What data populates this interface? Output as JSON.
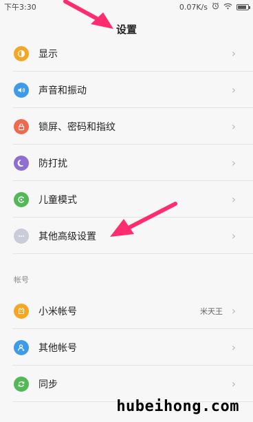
{
  "status": {
    "time": "下午3:30",
    "speed": "0.07K/s",
    "battery_level_percent": 85
  },
  "title": "设置",
  "group1": [
    {
      "label": "显示",
      "icon": "display-icon",
      "color": "#f5a623"
    },
    {
      "label": "声音和振动",
      "icon": "sound-icon",
      "color": "#3d9be9"
    },
    {
      "label": "锁屏、密码和指纹",
      "icon": "lock-icon",
      "color": "#f0684d"
    },
    {
      "label": "防打扰",
      "icon": "moon-icon",
      "color": "#8e6fd1"
    },
    {
      "label": "儿童模式",
      "icon": "kids-icon",
      "color": "#55b858"
    },
    {
      "label": "其他高级设置",
      "icon": "more-icon",
      "color": "#c8cdd8"
    }
  ],
  "section_account": "帐号",
  "group2": [
    {
      "label": "小米帐号",
      "value": "米天王",
      "icon": "mi-account-icon",
      "color": "#f5a623"
    },
    {
      "label": "其他帐号",
      "icon": "other-account-icon",
      "color": "#3d9be9"
    },
    {
      "label": "同步",
      "icon": "sync-icon",
      "color": "#55b858"
    }
  ],
  "chevron": "›",
  "watermark": "hubeihong.com",
  "colors": {
    "arrow": "#ff2d6f"
  }
}
